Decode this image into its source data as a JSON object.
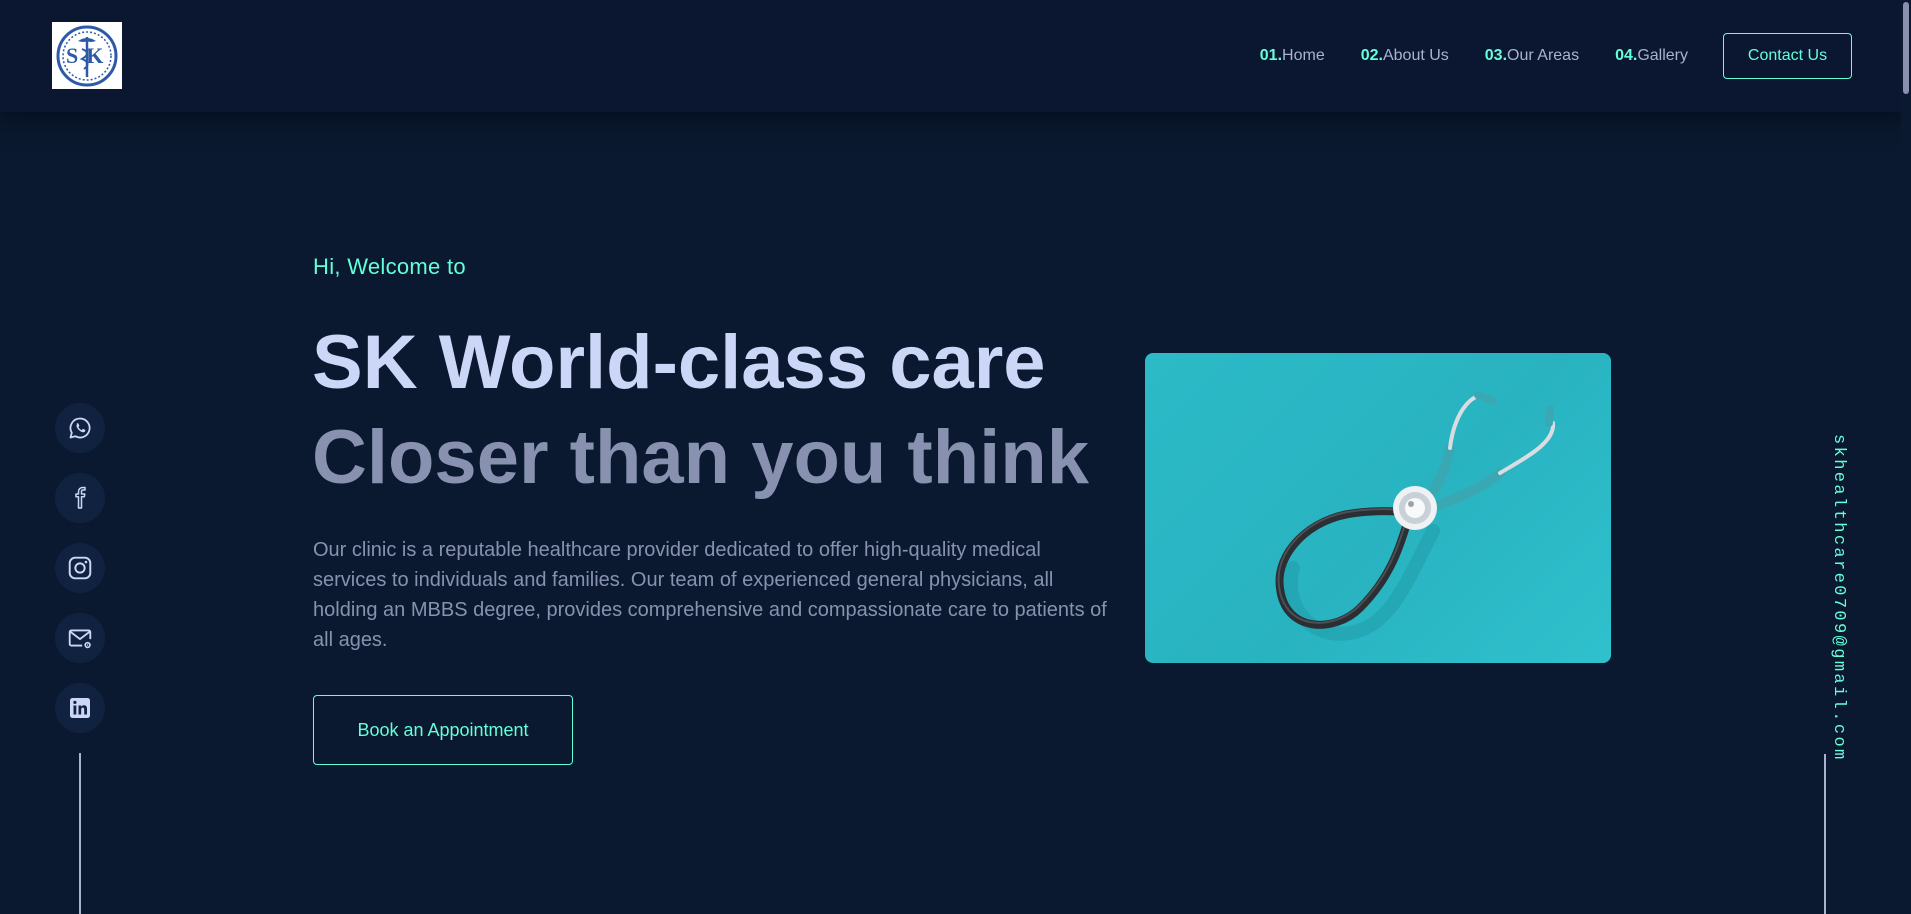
{
  "header": {
    "logo_text": "SK"
  },
  "nav": {
    "items": [
      {
        "num": "01.",
        "label": "Home"
      },
      {
        "num": "02.",
        "label": "About Us"
      },
      {
        "num": "03.",
        "label": "Our Areas"
      },
      {
        "num": "04.",
        "label": "Gallery"
      }
    ],
    "contact_label": "Contact Us"
  },
  "hero": {
    "greeting": "Hi, Welcome to",
    "title": "SK World-class care",
    "subtitle": "Closer than you think",
    "description": "Our clinic is a reputable healthcare provider dedicated to offer high-quality medical services to individuals and families. Our team of experienced general physicians, all holding an MBBS degree, provides comprehensive and compassionate care to patients of all ages.",
    "button_label": "Book an Appointment",
    "image_icon": "stethoscope-icon"
  },
  "social": {
    "icons": [
      "whatsapp-icon",
      "facebook-icon",
      "instagram-icon",
      "mail-icon",
      "linkedin-icon"
    ]
  },
  "email": {
    "address": "skhealthcare0709@gmail.com"
  },
  "colors": {
    "background": "#0a192f",
    "accent": "#64ffda",
    "heading": "#ccd6f6",
    "text": "#8892b0",
    "icon_bg": "#112240",
    "image_bg": "#2cbac7"
  }
}
